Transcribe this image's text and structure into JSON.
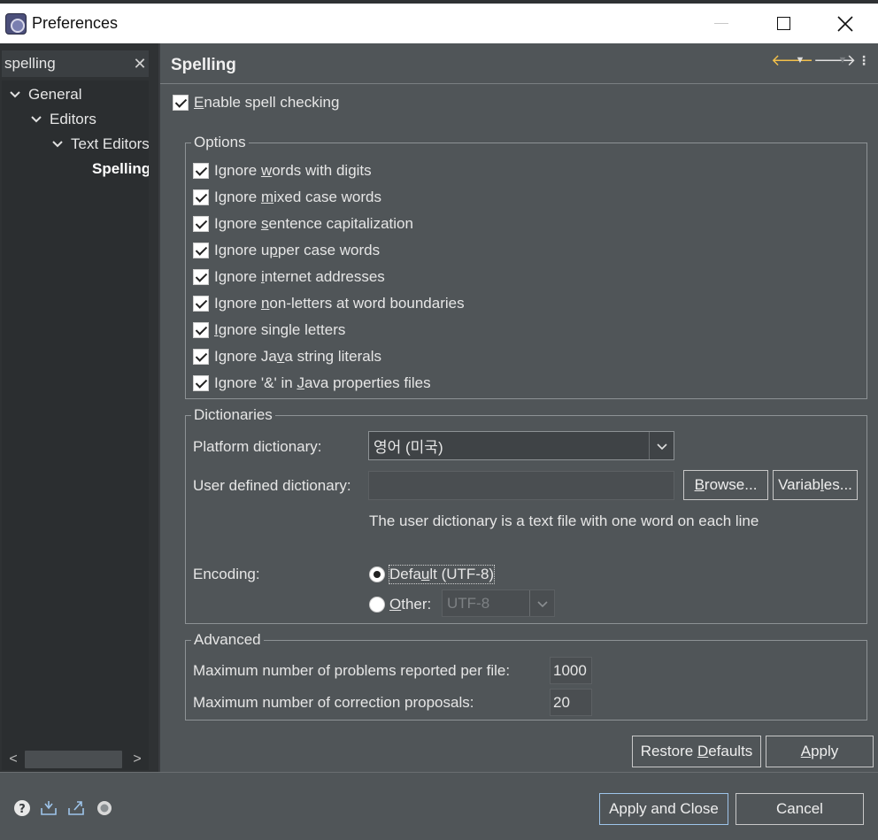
{
  "window": {
    "title": "Preferences",
    "close_glyph": "✕"
  },
  "filter": {
    "value": "spelling",
    "clear_glyph": "✕"
  },
  "tree": [
    {
      "label": "General",
      "expanded": true,
      "level": 0
    },
    {
      "label": "Editors",
      "expanded": true,
      "level": 1
    },
    {
      "label": "Text Editors",
      "expanded": true,
      "level": 2
    },
    {
      "label": "Spelling",
      "selected": true,
      "level": 3
    }
  ],
  "scroll": {
    "left_glyph": "<",
    "right_glyph": ">"
  },
  "page": {
    "title": "Spelling",
    "nav": {
      "back": "🡐",
      "forward": "🡒",
      "drop": "▼",
      "menu": "⋮"
    },
    "enable_spell_checking": {
      "pre": "",
      "key": "E",
      "post": "nable spell checking"
    }
  },
  "options": {
    "title": "Options",
    "items": [
      {
        "pre": "Ignore ",
        "key": "w",
        "post": "ords with digits"
      },
      {
        "pre": "Ignore ",
        "key": "m",
        "post": "ixed case words"
      },
      {
        "pre": "Ignore ",
        "key": "s",
        "post": "entence capitalization"
      },
      {
        "pre": "Ignore u",
        "key": "p",
        "post": "per case words"
      },
      {
        "pre": "Ignore ",
        "key": "i",
        "post": "nternet addresses"
      },
      {
        "pre": "Ignore ",
        "key": "n",
        "post": "on-letters at word boundaries"
      },
      {
        "pre": "",
        "key": "I",
        "post": "gnore single letters"
      },
      {
        "pre": "Ignore Ja",
        "key": "v",
        "post": "a string literals"
      },
      {
        "pre": "Ignore '&' in ",
        "key": "J",
        "post": "ava properties files"
      }
    ]
  },
  "dictionaries": {
    "title": "Dictionaries",
    "platform_label": "Platform dictionary:",
    "platform_value": "영어 (미국)",
    "user_label": "User defined dictionary:",
    "user_value": "",
    "browse": {
      "key": "B",
      "post": "rowse..."
    },
    "variables": {
      "pre": "Variab",
      "key": "l",
      "post": "es..."
    },
    "hint": "The user dictionary is a text file with one word on each line",
    "encoding_label": "Encoding:",
    "default_option": {
      "pre": "Defa",
      "key": "u",
      "post": "lt (UTF-8)"
    },
    "other_option": {
      "key": "O",
      "post": "ther:"
    },
    "other_value": "UTF-8"
  },
  "advanced": {
    "title": "Advanced",
    "max_problems_label": "Maximum number of problems reported per file:",
    "max_problems_value": "1000",
    "max_proposals_label": "Maximum number of correction proposals:",
    "max_proposals_value": "20"
  },
  "buttons": {
    "restore": {
      "pre": "Restore ",
      "key": "D",
      "post": "efaults"
    },
    "apply": {
      "key": "A",
      "post": "pply"
    },
    "apply_close": "Apply and Close",
    "cancel": "Cancel"
  }
}
